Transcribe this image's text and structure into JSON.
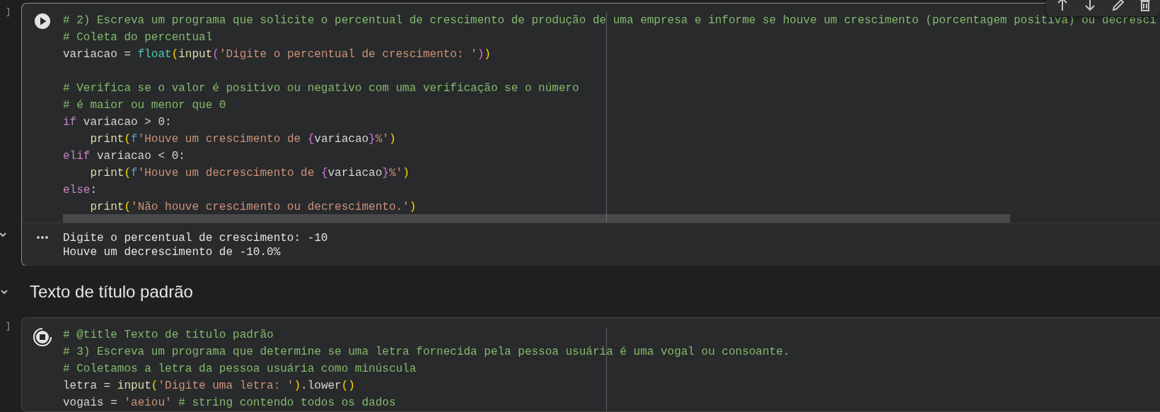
{
  "cells": [
    {
      "kind": "code",
      "gutter": "]",
      "running": false,
      "selected": true,
      "lines": [
        {
          "kind": "code",
          "tokens": [
            {
              "kind": "comment",
              "text": "# 2) Escreva um programa que solicite o percentual de crescimento de produção de uma empresa e informe se houve um crescimento (porcentagem positiva) ou decresci"
            }
          ]
        },
        {
          "kind": "code",
          "tokens": [
            {
              "kind": "comment",
              "text": "# Coleta do percentual"
            }
          ]
        },
        {
          "kind": "code",
          "tokens": [
            {
              "kind": "plain",
              "text": "variacao = "
            },
            {
              "kind": "builtin",
              "text": "float"
            },
            {
              "kind": "paren1",
              "text": "("
            },
            {
              "kind": "func",
              "text": "input"
            },
            {
              "kind": "paren2",
              "text": "("
            },
            {
              "kind": "string",
              "text": "'Digite o percentual de crescimento: '"
            },
            {
              "kind": "paren2",
              "text": ")"
            },
            {
              "kind": "paren1",
              "text": ")"
            }
          ]
        },
        {
          "kind": "blank"
        },
        {
          "kind": "code",
          "tokens": [
            {
              "kind": "comment",
              "text": "# Verifica se o valor é positivo ou negativo com uma verificação se o número"
            }
          ]
        },
        {
          "kind": "code",
          "tokens": [
            {
              "kind": "comment",
              "text": "# é maior ou menor que 0"
            }
          ]
        },
        {
          "kind": "code",
          "tokens": [
            {
              "kind": "keyword",
              "text": "if"
            },
            {
              "kind": "plain",
              "text": " variacao > 0:"
            }
          ]
        },
        {
          "kind": "code",
          "indented": true,
          "tokens": [
            {
              "kind": "func",
              "text": "print"
            },
            {
              "kind": "paren1",
              "text": "("
            },
            {
              "kind": "prefix",
              "text": "f"
            },
            {
              "kind": "string",
              "text": "'Houve um crescimento de "
            },
            {
              "kind": "brace",
              "text": "{"
            },
            {
              "kind": "plain",
              "text": "variacao"
            },
            {
              "kind": "brace",
              "text": "}"
            },
            {
              "kind": "string",
              "text": "%'"
            },
            {
              "kind": "paren1",
              "text": ")"
            }
          ]
        },
        {
          "kind": "code",
          "tokens": [
            {
              "kind": "keyword",
              "text": "elif"
            },
            {
              "kind": "plain",
              "text": " variacao < 0:"
            }
          ]
        },
        {
          "kind": "code",
          "indented": true,
          "tokens": [
            {
              "kind": "func",
              "text": "print"
            },
            {
              "kind": "paren1",
              "text": "("
            },
            {
              "kind": "prefix",
              "text": "f"
            },
            {
              "kind": "string",
              "text": "'Houve um decrescimento de "
            },
            {
              "kind": "brace",
              "text": "{"
            },
            {
              "kind": "plain",
              "text": "variacao"
            },
            {
              "kind": "brace",
              "text": "}"
            },
            {
              "kind": "string",
              "text": "%'"
            },
            {
              "kind": "paren1",
              "text": ")"
            }
          ]
        },
        {
          "kind": "code",
          "tokens": [
            {
              "kind": "keyword",
              "text": "else"
            },
            {
              "kind": "plain",
              "text": ":"
            }
          ]
        },
        {
          "kind": "code",
          "indented": true,
          "tokens": [
            {
              "kind": "func",
              "text": "print"
            },
            {
              "kind": "paren1",
              "text": "("
            },
            {
              "kind": "string",
              "text": "'Não houve crescimento ou decrescimento.'"
            },
            {
              "kind": "paren1",
              "text": ")"
            }
          ]
        }
      ],
      "output": {
        "expanded": true,
        "lines": [
          "Digite o percentual de crescimento: -10",
          "Houve um decrescimento de -10.0%"
        ]
      }
    },
    {
      "kind": "heading",
      "expanded": true,
      "text": "Texto de título padrão"
    },
    {
      "kind": "code",
      "gutter": "]",
      "running": true,
      "selected": false,
      "lines": [
        {
          "kind": "code",
          "tokens": [
            {
              "kind": "comment",
              "text": "# @title Texto de título padrão"
            }
          ]
        },
        {
          "kind": "code",
          "tokens": [
            {
              "kind": "comment",
              "text": "# 3) Escreva um programa que determine se uma letra fornecida pela pessoa usuária é uma vogal ou consoante."
            }
          ]
        },
        {
          "kind": "code",
          "tokens": [
            {
              "kind": "comment",
              "text": "# Coletamos a letra da pessoa usuária como minúscula"
            }
          ]
        },
        {
          "kind": "code",
          "tokens": [
            {
              "kind": "plain",
              "text": "letra = "
            },
            {
              "kind": "func",
              "text": "input"
            },
            {
              "kind": "paren1",
              "text": "("
            },
            {
              "kind": "string",
              "text": "'Digite uma letra: '"
            },
            {
              "kind": "paren1",
              "text": ")"
            },
            {
              "kind": "plain",
              "text": ".lower"
            },
            {
              "kind": "paren1",
              "text": "()"
            }
          ]
        },
        {
          "kind": "code",
          "tokens": [
            {
              "kind": "plain",
              "text": "vogais = "
            },
            {
              "kind": "string",
              "text": "'aeiou'"
            },
            {
              "kind": "comment",
              "space_before": true,
              "text": "# string contendo todos os dados"
            }
          ]
        }
      ]
    }
  ]
}
